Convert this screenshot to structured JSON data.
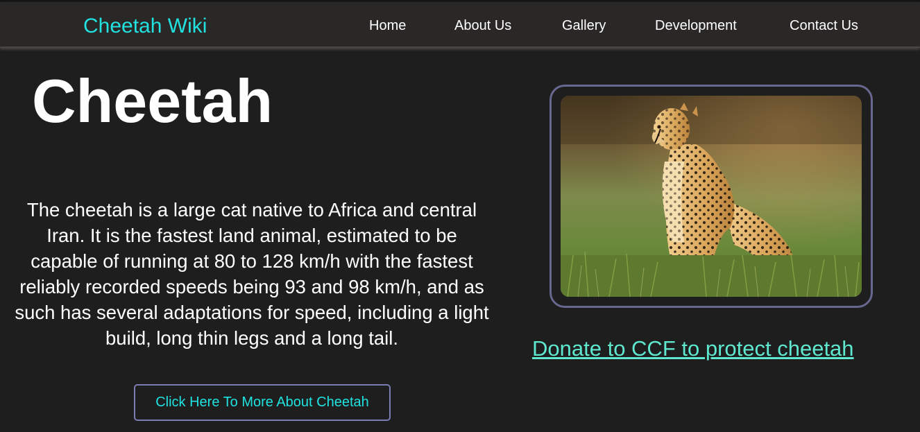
{
  "nav": {
    "brand": "Cheetah Wiki",
    "links": [
      "Home",
      "About Us",
      "Gallery",
      "Development",
      "Contact Us"
    ]
  },
  "hero": {
    "title": "Cheetah",
    "description": "The cheetah is a large cat native to Africa and central Iran. It is the fastest land animal, estimated to be capable of running at 80 to 128 km/h with the fastest reliably recorded speeds being 93 and 98 km/h, and as such has several adaptations for speed, including a light build, long thin legs and a long tail.",
    "button_label": "Click Here To More About Cheetah"
  },
  "donate": {
    "label": "Donate to CCF to protect cheetah"
  },
  "colors": {
    "background": "#1e1e1e",
    "navbar": "#2a2727",
    "brand": "#22e2e0",
    "accent_border": "#7b7bb5",
    "donate_link": "#5ee8cf"
  },
  "image": {
    "subject": "cheetah-photo"
  }
}
